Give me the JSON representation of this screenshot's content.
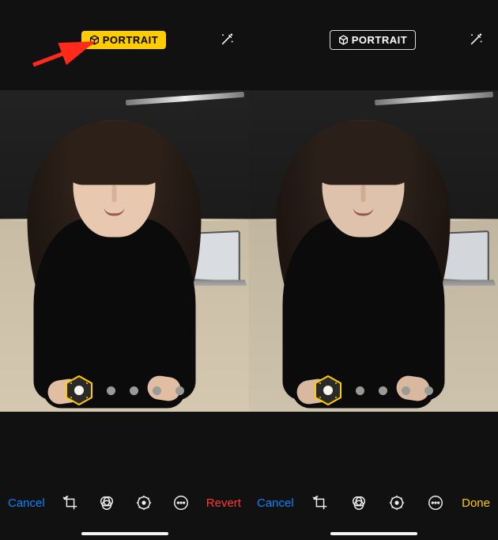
{
  "left": {
    "top": {
      "badge_label": "PORTRAIT",
      "badge_active": true
    },
    "toolbar": {
      "cancel": "Cancel",
      "action": "Revert"
    },
    "lighting_dots": 5,
    "lighting_selected_index": 0
  },
  "right": {
    "top": {
      "badge_label": "PORTRAIT",
      "badge_active": false
    },
    "toolbar": {
      "cancel": "Cancel",
      "action": "Done"
    },
    "lighting_dots": 5,
    "lighting_selected_index": 0
  },
  "icons": {
    "wand": "magic-wand-icon",
    "crop": "crop-rotate-icon",
    "filters": "filters-icon",
    "adjust": "adjust-dial-icon",
    "more": "more-circle-icon",
    "hex": "portrait-lighting-hex-icon",
    "cube": "cube-icon"
  },
  "colors": {
    "accent_yellow": "#ffcc00",
    "link_blue": "#0a84ff",
    "destructive_red": "#ff3b30",
    "background": "#111111"
  },
  "annotation": {
    "arrow_target": "left.top.portrait_badge"
  }
}
